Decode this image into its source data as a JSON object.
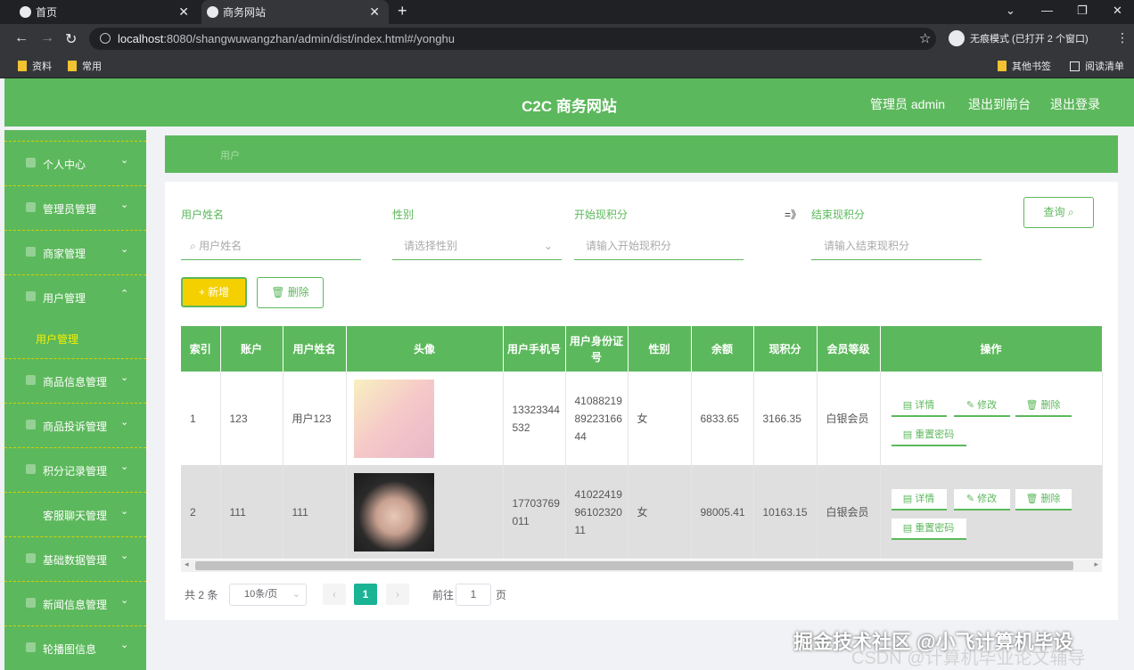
{
  "browser": {
    "tabs": [
      {
        "label": "首页"
      },
      {
        "label": "商务网站"
      }
    ],
    "url_host": "localhost",
    "url_rest": ":8080/shangwuwangzhan/admin/dist/index.html#/yonghu",
    "incognito_label": "无痕模式 (已打开 2 个窗口)",
    "bookmarks": [
      "资料",
      "常用"
    ],
    "bookmarks_right": [
      "其他书签",
      "阅读清单"
    ]
  },
  "header": {
    "title": "C2C 商务网站",
    "admin_label": "管理员 admin",
    "to_front_label": "退出到前台",
    "logout_label": "退出登录"
  },
  "sidebar": {
    "items": [
      {
        "label": "个人中心"
      },
      {
        "label": "管理员管理"
      },
      {
        "label": "商家管理"
      },
      {
        "label": "用户管理"
      },
      {
        "label": "商品信息管理"
      },
      {
        "label": "商品投诉管理"
      },
      {
        "label": "积分记录管理"
      },
      {
        "label": "客服聊天管理"
      },
      {
        "label": "基础数据管理"
      },
      {
        "label": "新闻信息管理"
      },
      {
        "label": "轮播图信息"
      }
    ],
    "active_sub": "用户管理"
  },
  "breadcrumb": "用户",
  "filters": {
    "name_label": "用户姓名",
    "name_placeholder": "用户姓名",
    "gender_label": "性别",
    "gender_placeholder": "请选择性别",
    "start_label": "开始现积分",
    "start_placeholder": "请输入开始现积分",
    "range_sep": "=》",
    "end_label": "结束现积分",
    "end_placeholder": "请输入结束现积分",
    "query_label": "查询"
  },
  "actions": {
    "add_label": "新增",
    "delete_label": "删除"
  },
  "table": {
    "headers": [
      "索引",
      "账户",
      "用户姓名",
      "头像",
      "用户手机号",
      "用户身份证号",
      "性别",
      "余额",
      "现积分",
      "会员等级",
      "操作"
    ],
    "rows": [
      {
        "index": "1",
        "account": "123",
        "name": "用户123",
        "phone": "13323344532",
        "idcard": "410882198922316644",
        "gender": "女",
        "balance": "6833.65",
        "points": "3166.35",
        "level": "白银会员"
      },
      {
        "index": "2",
        "account": "111",
        "name": "111",
        "phone": "17703769011",
        "idcard": "410224199610232011",
        "gender": "女",
        "balance": "98005.41",
        "points": "10163.15",
        "level": "白银会员"
      }
    ],
    "op_labels": {
      "detail": "详情",
      "edit": "修改",
      "delete": "删除",
      "reset": "重置密码"
    }
  },
  "pagination": {
    "total_text": "共 2 条",
    "page_size": "10条/页",
    "current": "1",
    "goto_label": "前往",
    "goto_value": "1",
    "page_suffix": "页"
  },
  "watermark": "掘金技术社区 @小飞计算机毕设",
  "watermark2": "CSDN @计算机毕业论文辅导",
  "colors": {
    "primary": "#5cb85c",
    "accent": "#f5d000",
    "page_active": "#1ab394"
  }
}
